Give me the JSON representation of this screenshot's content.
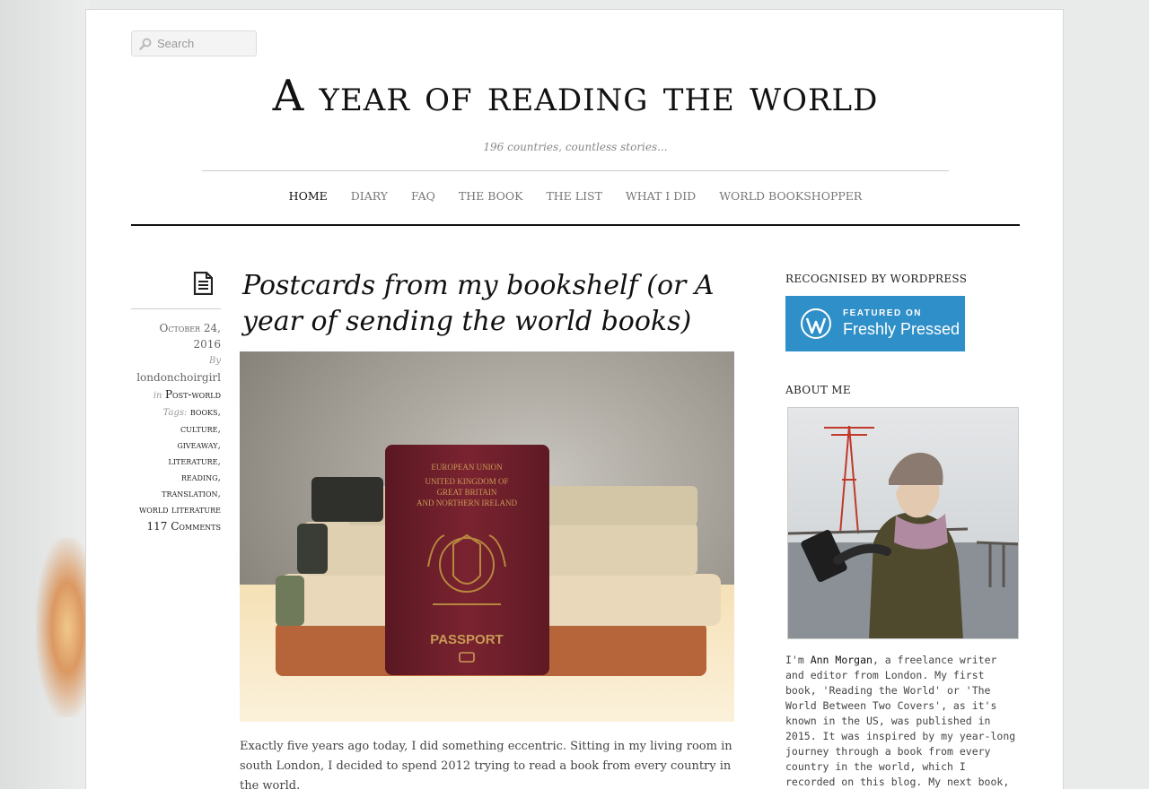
{
  "search": {
    "placeholder": "Search"
  },
  "site": {
    "title": "A year of reading the world",
    "tagline": "196 countries, countless stories..."
  },
  "nav": {
    "items": [
      "HOME",
      "DIARY",
      "FAQ",
      "THE BOOK",
      "THE LIST",
      "WHAT I DID",
      "WORLD BOOKSHOPPER"
    ],
    "active": "HOME"
  },
  "post": {
    "title": "Postcards from my bookshelf (or A year of sending the world books)",
    "date": "October 24, 2016",
    "by_label": "By",
    "author": "londonchoirgirl",
    "in_label": "in",
    "category": "Post-world",
    "tags_label": "Tags:",
    "tags": [
      "books",
      "culture",
      "giveaway",
      "literature",
      "reading",
      "translation",
      "world literature"
    ],
    "comments": "117 Comments",
    "image_passport_header": [
      "EUROPEAN UNION",
      "UNITED KINGDOM OF",
      "GREAT BRITAIN",
      "AND NORTHERN IRELAND"
    ],
    "image_passport_label": "PASSPORT",
    "excerpt": "Exactly five years ago today, I did something eccentric. Sitting in my living room in south London, I decided to spend 2012 trying to read a book from every country in the world."
  },
  "sidebar": {
    "recognised_title": "RECOGNISED BY WORDPRESS",
    "badge_small": "FEATURED ON",
    "badge_large": "Freshly Pressed",
    "about_title": "ABOUT ME",
    "about_intro": "I'm ",
    "about_name": "Ann Morgan",
    "about_text": ", a freelance writer and editor from London. My first book, 'Reading the World' or 'The World Between Two Covers', as it's known in the US, was published in 2015. It was inspired by my year-long journey through a book from every country in the world, which I recorded on this blog. My next book, a novel called 'Beside Myself', is published worldwide in"
  },
  "colors": {
    "badge_blue": "#2f8fc8",
    "rule_dark": "#111111"
  }
}
